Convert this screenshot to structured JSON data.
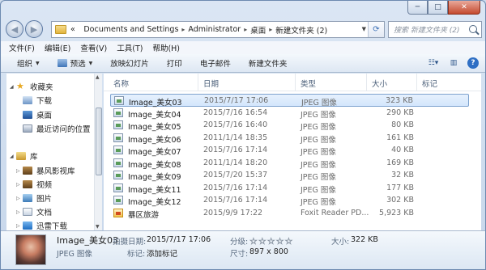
{
  "window": {
    "caption": {
      "minimize": "─",
      "maximize": "□",
      "close": "✕"
    }
  },
  "address": {
    "lead": "«",
    "crumbs": [
      "Documents and Settings",
      "Administrator",
      "桌面",
      "新建文件夹 (2)"
    ],
    "search_placeholder": "搜索 新建文件夹 (2)"
  },
  "menu": [
    "文件(F)",
    "编辑(E)",
    "查看(V)",
    "工具(T)",
    "帮助(H)"
  ],
  "toolbar": {
    "organize": "组织",
    "preview": "预选",
    "slideshow": "放映幻灯片",
    "print": "打印",
    "email": "电子邮件",
    "new_folder": "新建文件夹"
  },
  "nav": {
    "favorites": "收藏夹",
    "downloads": "下载",
    "desktop": "桌面",
    "recent": "最近访问的位置",
    "libraries": "库",
    "storm": "暴风影视库",
    "videos": "视频",
    "pictures": "图片",
    "documents": "文档",
    "thunder": "迅雷下载"
  },
  "columns": {
    "name": "名称",
    "date": "日期",
    "type": "类型",
    "size": "大小",
    "tags": "标记"
  },
  "files": [
    {
      "name": "Image_美女03",
      "date": "2015/7/17 17:06",
      "type": "JPEG 图像",
      "size": "323 KB",
      "kind": "jpg"
    },
    {
      "name": "Image_美女04",
      "date": "2015/7/16 16:54",
      "type": "JPEG 图像",
      "size": "290 KB",
      "kind": "jpg"
    },
    {
      "name": "Image_美女05",
      "date": "2015/7/16 16:40",
      "type": "JPEG 图像",
      "size": "80 KB",
      "kind": "jpg"
    },
    {
      "name": "Image_美女06",
      "date": "2011/1/14 18:35",
      "type": "JPEG 图像",
      "size": "161 KB",
      "kind": "jpg"
    },
    {
      "name": "Image_美女07",
      "date": "2015/7/16 17:14",
      "type": "JPEG 图像",
      "size": "40 KB",
      "kind": "jpg"
    },
    {
      "name": "Image_美女08",
      "date": "2011/1/14 18:20",
      "type": "JPEG 图像",
      "size": "169 KB",
      "kind": "jpg"
    },
    {
      "name": "Image_美女09",
      "date": "2015/7/20 15:37",
      "type": "JPEG 图像",
      "size": "32 KB",
      "kind": "jpg"
    },
    {
      "name": "Image_美女11",
      "date": "2015/7/16 17:14",
      "type": "JPEG 图像",
      "size": "177 KB",
      "kind": "jpg"
    },
    {
      "name": "Image_美女12",
      "date": "2015/7/16 17:14",
      "type": "JPEG 图像",
      "size": "302 KB",
      "kind": "jpg"
    },
    {
      "name": "暴区旅游",
      "date": "2015/9/9 17:22",
      "type": "Foxit Reader PD...",
      "size": "5,923 KB",
      "kind": "pdf"
    }
  ],
  "details": {
    "filename": "Image_美女03",
    "filetype": "JPEG 图像",
    "date_label": "拍摄日期:",
    "date_value": "2015/7/17 17:06",
    "tags_label": "标记:",
    "tags_value": "添加标记",
    "rating_label": "分级:",
    "rating": 0,
    "rating_max": 5,
    "dims_label": "尺寸:",
    "dims_value": "897 x 800",
    "size_label": "大小:",
    "size_value": "322 KB"
  },
  "colors": {
    "selection_border": "#7da2ce",
    "selection_fill": "#d3e6fc",
    "header_text": "#4c607a"
  }
}
